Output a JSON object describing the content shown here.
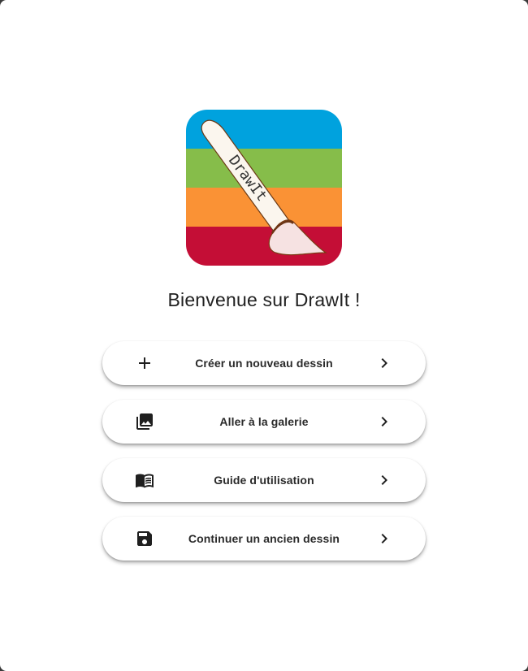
{
  "logo": {
    "text": "DrawIt",
    "stripe_colors": [
      "#00a2de",
      "#86bd4a",
      "#fa9235",
      "#c40e36"
    ]
  },
  "welcome": "Bienvenue sur DrawIt !",
  "menu": [
    {
      "label": "Créer un nouveau dessin",
      "icon": "plus-icon"
    },
    {
      "label": "Aller à la galerie",
      "icon": "gallery-icon"
    },
    {
      "label": "Guide d'utilisation",
      "icon": "book-icon"
    },
    {
      "label": "Continuer un ancien dessin",
      "icon": "save-icon"
    }
  ],
  "colors": {
    "background": "#ffffff",
    "text": "#212121",
    "icon": "#1f1f1f"
  }
}
